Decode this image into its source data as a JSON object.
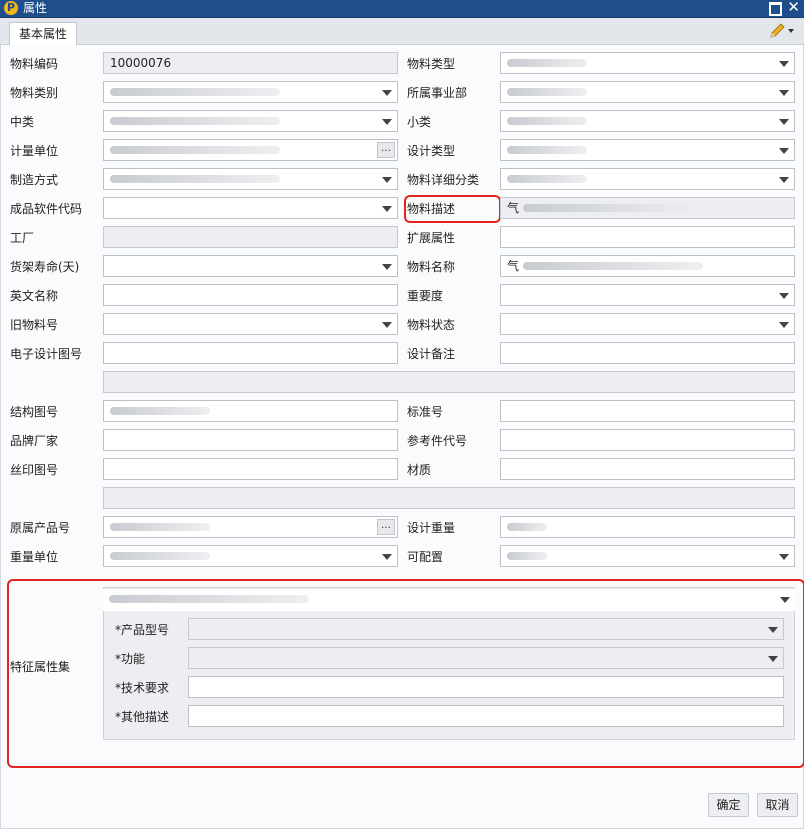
{
  "window": {
    "title": "属性",
    "logo": "P"
  },
  "tabs": [
    {
      "label": "基本属性"
    }
  ],
  "labels": {
    "material_code": "物料编码",
    "material_type": "物料类型",
    "material_category": "物料类别",
    "business_unit": "所属事业部",
    "middle_class": "中类",
    "small_class": "小类",
    "unit": "计量单位",
    "design_type": "设计类型",
    "manufacture": "制造方式",
    "detail_class": "物料详细分类",
    "software_code": "成品软件代码",
    "material_desc": "物料描述",
    "factory": "工厂",
    "ext_attr": "扩展属性",
    "shelf_life": "货架寿命(天)",
    "material_name": "物料名称",
    "english_name": "英文名称",
    "importance": "重要度",
    "old_material_no": "旧物料号",
    "material_status": "物料状态",
    "e_design_drawing": "电子设计图号",
    "design_note": "设计备注",
    "structure_drawing": "结构图号",
    "standard_no": "标准号",
    "brand_vendor": "品牌厂家",
    "ref_part_code": "参考件代号",
    "silkscreen_drawing": "丝印图号",
    "material_quality": "材质",
    "orig_product_no": "原属产品号",
    "design_weight": "设计重量",
    "weight_unit": "重量单位",
    "configurable": "可配置",
    "feature_set": "特征属性集",
    "product_model": "*产品型号",
    "function": "*功能",
    "tech_req": "*技术要求",
    "other_desc": "*其他描述"
  },
  "values": {
    "material_code": "10000076",
    "material_desc_prefix": "气",
    "material_name_prefix": "气"
  },
  "buttons": {
    "ok": "确定",
    "cancel": "取消"
  },
  "icons": {
    "logo": "app-logo-icon",
    "maximize": "maximize-icon",
    "close": "close-icon",
    "edit": "pencil-icon",
    "dropdown": "chevron-down-icon",
    "ellipsis": "ellipsis-icon"
  },
  "colors": {
    "titlebar": "#1f4f8a",
    "highlight": "#e3241e"
  }
}
